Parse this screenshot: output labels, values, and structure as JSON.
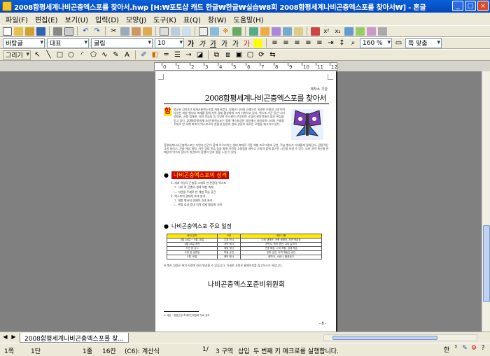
{
  "window": {
    "title": "2008함평세계나비곤충엑스포를 찾아서.hwp [H:₩포토샵 캐드 한글₩한글₩실습₩8회 2008함평세계나비곤충엑스포를 찾아서₩] - 혼글",
    "minimize": "_",
    "maximize": "□",
    "close": "×"
  },
  "menu": [
    "파일(F)",
    "편집(E)",
    "보기(U)",
    "입력(D)",
    "모양(J)",
    "도구(K)",
    "표(Q)",
    "창(W)",
    "도움말(H)"
  ],
  "format_toolbar": {
    "style": "바탕글",
    "lang_font": "대표",
    "font": "굴림",
    "size": "10",
    "zoom": "160 %",
    "fit": "쪽 맞춤"
  },
  "draw_toolbar": {
    "label": "그리기"
  },
  "ruler": {
    "marks": [
      "0",
      "1",
      "2",
      "3",
      "4",
      "5",
      "6",
      "7",
      "8",
      "9",
      "10",
      "11",
      "12"
    ]
  },
  "document": {
    "header_small": "제작소 기관",
    "title": "2008함평세계나비곤충엑스포를 찾아서",
    "dropcap": "함",
    "intro": "평군은 2014년 세계곤충엑스포를 개최하였다. 함평은 나비와 곤충으로 유명한 친환경 고장이며 다양한 체험 행사와 축제를 통해 지역 경제 활성화에 크게 기여하고 있다. 엑스포 기간 동안 나비 생태관, 곤충 생태관, 자연 학습장 등 다양한 전시관이 운영되며 국내외 관람객들의 많은 관심을 받고 있다. 2008함평세계나비곤충엑스포는 함평 엑스포공원 일원에서 개최되며 나비와 곤충을 주제로 한 세계 최초의 엑스포로서 친환경 농업과 생태 관광의 새로운 모델을 제시하고 있다.",
    "para2": "함평세계나비곤충엑스포는 자연과 인간이 함께 어우러지는 생태 축제로 각종 체험 프로그램과 공연, 학술 행사가 다채롭게 펼쳐진다. 관람객은 나비 날리기, 곤충 채집 체험, 자연 생태 학습 등을 통해 자연의 소중함을 배우고 가족과 함께 즐거운 시간을 보낼 수 있다. 또한 지역 특산물 판매장과 먹거리 장터가 마련되어 함평의 맛과 멋을 느낄 수 있다.",
    "section1": {
      "bullet": "●",
      "title": "나비곤충엑스포의 성격"
    },
    "list1": [
      "1. 세계 유일의 곤충을 소재로 한 친환경 엑스포",
      "ㄱ. 나비 와 곤충의 생태 체험 축제",
      "ㄴ. 자연을 주제로 한 체험 학습 공간",
      "2. 엑스포의 경제적 효과 분석",
      "ㄱ. 체험 행사의 경제적 효과 분석",
      "ㄴ. 관광 효과 증대 지역 경제 활성화 기여"
    ],
    "section2": {
      "bullet": "●",
      "title": "나비곤충엑스포 주요 일정"
    },
    "schedule": {
      "headers": [
        "행사 일자",
        "구분",
        "세부 내용"
      ],
      "rows": [
        [
          "4월 18일 ~ 5월 18일",
          "주제 전시",
          "나비 생태관, 곤충 생태관, 자연 학습장"
        ],
        [
          "4월 18일 개막",
          "개막 행사",
          "개막식, 축하 공연, 나비 날리기"
        ],
        [
          "기간 중 상시",
          "체험 행사",
          "곤충 채집, 나비 체험, 생태 학습"
        ],
        [
          "주말 및 공휴일",
          "특별 공연",
          "문화 공연, 지역 예술단 공연"
        ],
        [
          "5월 18일",
          "폐막 행사",
          "폐막식, 시상식, 불꽃놀이"
        ]
      ]
    },
    "note": "※ 행사 일정은 현지 사정에 따라 변경될 수 있습니다. 자세한 사항은 홈페이지를 참고하시기 바랍니다.",
    "committee": "나비곤충엑스포준비위원회",
    "footnote": "※ 제공 : 함평군청 축제추진위원회 자료 참조",
    "page_number": "- 8 -"
  },
  "doc_tab": "2008함평세계나비곤충엑스포를 찾...",
  "status": {
    "page": "1쪽",
    "section": "1단",
    "line": "1줄",
    "column": "16칸",
    "cell": "(C6): 계산식",
    "pages": "1/",
    "region": "3 구역",
    "mode": "삽입",
    "message": "두 번째 키 매크로를 실행합니다.",
    "ime": "한"
  },
  "colors": {
    "titlebar": "#0a5fd8",
    "highlight_yellow": "#ffeb00",
    "highlight_red": "#cc0000",
    "chrome": "#ece9d8"
  }
}
